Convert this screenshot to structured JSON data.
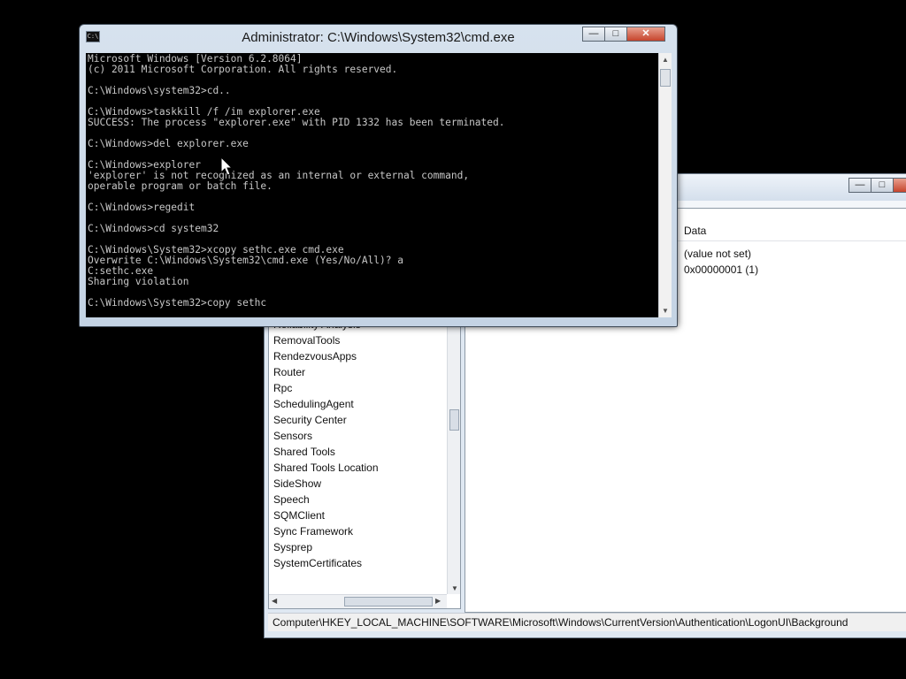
{
  "cmd": {
    "title": "Administrator: C:\\Windows\\System32\\cmd.exe",
    "icon": "C:\\",
    "lines": [
      "Microsoft Windows [Version 6.2.8064]",
      "(c) 2011 Microsoft Corporation. All rights reserved.",
      "",
      "C:\\Windows\\system32>cd..",
      "",
      "C:\\Windows>taskkill /f /im explorer.exe",
      "SUCCESS: The process \"explorer.exe\" with PID 1332 has been terminated.",
      "",
      "C:\\Windows>del explorer.exe",
      "",
      "C:\\Windows>explorer",
      "'explorer' is not recognized as an internal or external command,",
      "operable program or batch file.",
      "",
      "C:\\Windows>regedit",
      "",
      "C:\\Windows>cd system32",
      "",
      "C:\\Windows\\System32>xcopy sethc.exe cmd.exe",
      "Overwrite C:\\Windows\\System32\\cmd.exe (Yes/No/All)? a",
      "C:sethc.exe",
      "Sharing violation",
      "",
      "C:\\Windows\\System32>copy sethc"
    ]
  },
  "regedit": {
    "tree_items": [
      "Reliability Analysis",
      "RemovalTools",
      "RendezvousApps",
      "Router",
      "Rpc",
      "SchedulingAgent",
      "Security Center",
      "Sensors",
      "Shared Tools",
      "Shared Tools Location",
      "SideShow",
      "Speech",
      "SQMClient",
      "Sync Framework",
      "Sysprep",
      "SystemCertificates"
    ],
    "column_data": "Data",
    "values": [
      "(value not set)",
      "0x00000001 (1)"
    ],
    "status_path": "Computer\\HKEY_LOCAL_MACHINE\\SOFTWARE\\Microsoft\\Windows\\CurrentVersion\\Authentication\\LogonUI\\Background"
  },
  "colors": {
    "console_bg": "#000000",
    "console_text": "#c7c7c7",
    "close_button": "#c6442c"
  }
}
